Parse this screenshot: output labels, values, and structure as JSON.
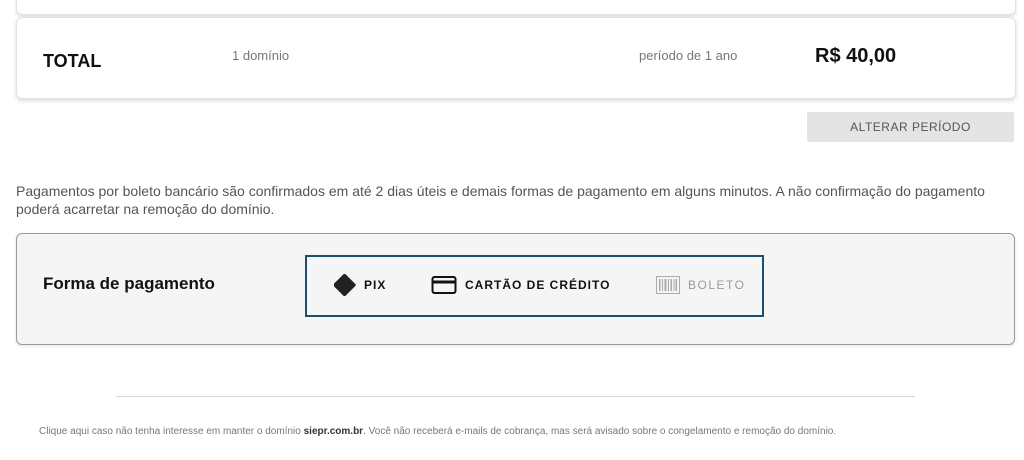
{
  "total": {
    "label": "TOTAL",
    "domains": "1 domínio",
    "period": "período de 1 ano",
    "price": "R$ 40,00"
  },
  "alter_button": "ALTERAR PERÍODO",
  "notice": "Pagamentos por boleto bancário são confirmados em até 2 dias úteis e demais formas de pagamento em alguns minutos. A não confirmação do pagamento poderá acarretar na remoção do domínio.",
  "payment": {
    "title": "Forma de pagamento",
    "methods": [
      {
        "label": "PIX",
        "icon": "pix-icon",
        "enabled": true
      },
      {
        "label": "CARTÃO DE CRÉDITO",
        "icon": "credit-card-icon",
        "enabled": true
      },
      {
        "label": "BOLETO",
        "icon": "barcode-icon",
        "enabled": false
      }
    ],
    "selected_border_color": "#1c4e6e"
  },
  "footer": {
    "prefix": "Clique aqui caso não tenha interesse em manter o domínio ",
    "domain": "siepr.com.br",
    "suffix": ". Você não receberá e-mails de cobrança, mas será avisado sobre o congelamento e remoção do domínio."
  }
}
